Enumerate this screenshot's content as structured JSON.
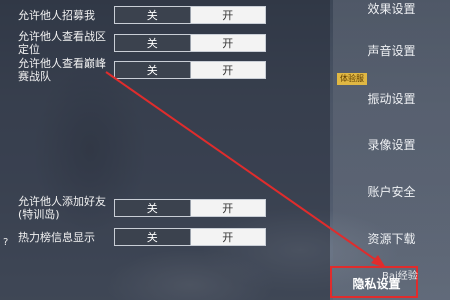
{
  "rows": [
    {
      "label": "允许他人招募我",
      "off": "关",
      "on": "开"
    },
    {
      "label": "允许他人查看战区定位",
      "off": "关",
      "on": "开"
    },
    {
      "label": "允许他人查看巅峰赛战队",
      "off": "关",
      "on": "开"
    },
    {
      "label": "允许他人添加好友(特训岛)",
      "off": "关",
      "on": "开"
    },
    {
      "label": "热力榜信息显示",
      "off": "关",
      "on": "开"
    }
  ],
  "help": "?",
  "sidebar": {
    "items": [
      {
        "label": "效果设置"
      },
      {
        "label": "声音设置"
      },
      {
        "label": "振动设置"
      },
      {
        "label": "录像设置"
      },
      {
        "label": "账户安全"
      },
      {
        "label": "资源下载"
      },
      {
        "label": "隐私设置"
      }
    ],
    "badge": "体验服"
  },
  "watermark": "Bai经验",
  "colors": {
    "highlight": "#e02c2c",
    "badge": "#e0b743"
  }
}
